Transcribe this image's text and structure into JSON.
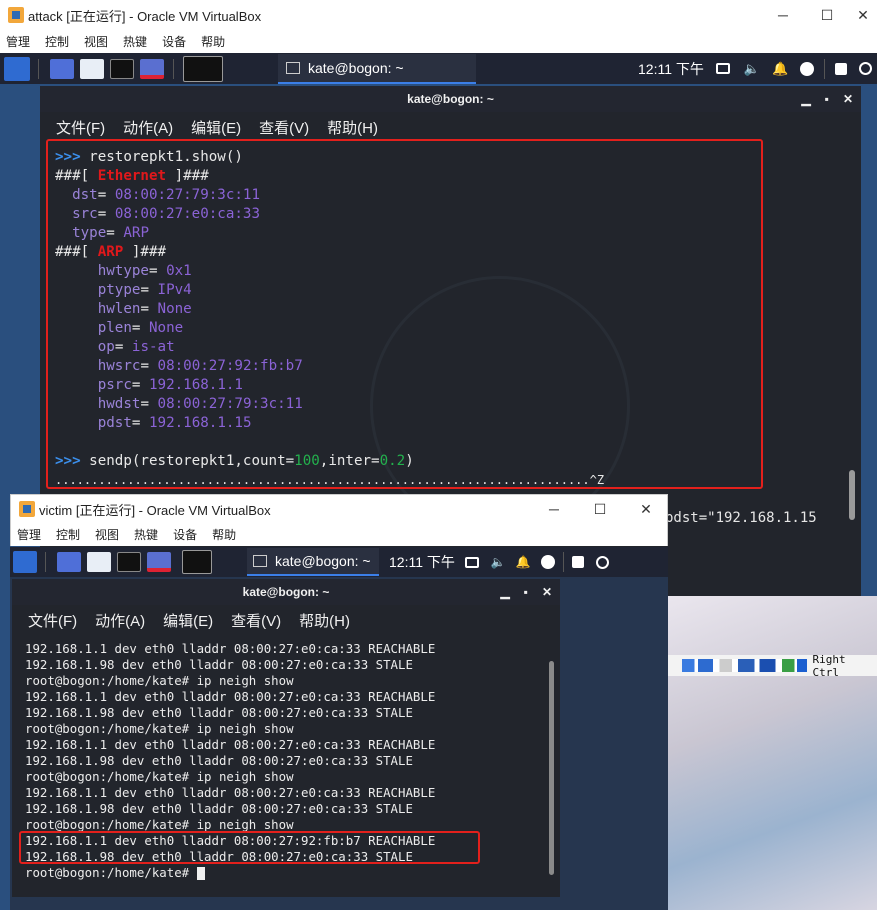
{
  "attack": {
    "title": "attack [正在运行] - Oracle VM VirtualBox",
    "menu": [
      "管理",
      "控制",
      "视图",
      "热键",
      "设备",
      "帮助"
    ],
    "controls": {
      "minimize": "─",
      "maximize": "☐",
      "close": "✕"
    },
    "taskbar": {
      "task_label": "kate@bogon: ~",
      "clock": "12:11 下午"
    },
    "terminal": {
      "title": "kate@bogon: ~",
      "controls": {
        "minimize": "▁",
        "maximize": "▪",
        "close": "✕"
      },
      "menu": [
        "文件(F)",
        "动作(A)",
        "编辑(E)",
        "查看(V)",
        "帮助(H)"
      ],
      "prompt": ">>>",
      "cmd1": "restorepkt1.show()",
      "eth_open": "###[ ",
      "eth_name": "Ethernet",
      "eth_close": " ]###",
      "eth_fields": [
        {
          "k": "dst",
          "v": "08:00:27:79:3c:11"
        },
        {
          "k": "src",
          "v": "08:00:27:e0:ca:33"
        },
        {
          "k": "type",
          "v": "ARP"
        }
      ],
      "arp_open": "###[ ",
      "arp_name": "ARP",
      "arp_close": " ]###",
      "arp_fields": [
        {
          "k": "hwtype",
          "v": "0x1"
        },
        {
          "k": "ptype",
          "v": "IPv4"
        },
        {
          "k": "hwlen",
          "v": "None"
        },
        {
          "k": "plen",
          "v": "None"
        },
        {
          "k": "op",
          "v": "is-at"
        },
        {
          "k": "hwsrc",
          "v": "08:00:27:92:fb:b7"
        },
        {
          "k": "psrc",
          "v": "192.168.1.1"
        },
        {
          "k": "hwdst",
          "v": "08:00:27:79:3c:11"
        },
        {
          "k": "pdst",
          "v": "192.168.1.15"
        }
      ],
      "cmd2_a": "sendp(restorepkt1,count=",
      "cmd2_count": "100",
      "cmd2_b": ",inter=",
      "cmd2_inter": "0.2",
      "cmd2_c": ")",
      "dots": "..........................................................................",
      "dots_tail": "^Z",
      "partial_line": "pdst=\"192.168.1.15"
    }
  },
  "victim": {
    "title": "victim [正在运行] - Oracle VM VirtualBox",
    "menu": [
      "管理",
      "控制",
      "视图",
      "热键",
      "设备",
      "帮助"
    ],
    "controls": {
      "minimize": "─",
      "maximize": "☐",
      "close": "✕"
    },
    "taskbar": {
      "task_label": "kate@bogon: ~",
      "clock": "12:11 下午"
    },
    "terminal": {
      "title": "kate@bogon: ~",
      "controls": {
        "minimize": "▁",
        "maximize": "▪",
        "close": "✕"
      },
      "menu": [
        "文件(F)",
        "动作(A)",
        "编辑(E)",
        "查看(V)",
        "帮助(H)"
      ],
      "lines": [
        "192.168.1.1 dev eth0 lladdr 08:00:27:e0:ca:33 REACHABLE",
        "192.168.1.98 dev eth0 lladdr 08:00:27:e0:ca:33 STALE",
        "root@bogon:/home/kate# ip neigh show",
        "192.168.1.1 dev eth0 lladdr 08:00:27:e0:ca:33 REACHABLE",
        "192.168.1.98 dev eth0 lladdr 08:00:27:e0:ca:33 STALE",
        "root@bogon:/home/kate# ip neigh show",
        "192.168.1.1 dev eth0 lladdr 08:00:27:e0:ca:33 REACHABLE",
        "192.168.1.98 dev eth0 lladdr 08:00:27:e0:ca:33 STALE",
        "root@bogon:/home/kate# ip neigh show",
        "192.168.1.1 dev eth0 lladdr 08:00:27:e0:ca:33 REACHABLE",
        "192.168.1.98 dev eth0 lladdr 08:00:27:e0:ca:33 STALE",
        "root@bogon:/home/kate# ip neigh show",
        "192.168.1.1 dev eth0 lladdr 08:00:27:92:fb:b7 REACHABLE",
        "192.168.1.98 dev eth0 lladdr 08:00:27:e0:ca:33 STALE",
        "root@bogon:/home/kate# "
      ]
    }
  },
  "host_status": {
    "hotkey_label": "Right Ctrl"
  },
  "colors": {
    "highlight": "#e3201c",
    "terminal_bg": "#22252c",
    "prompt": "#3b8eea",
    "field": "#8b63d6"
  }
}
